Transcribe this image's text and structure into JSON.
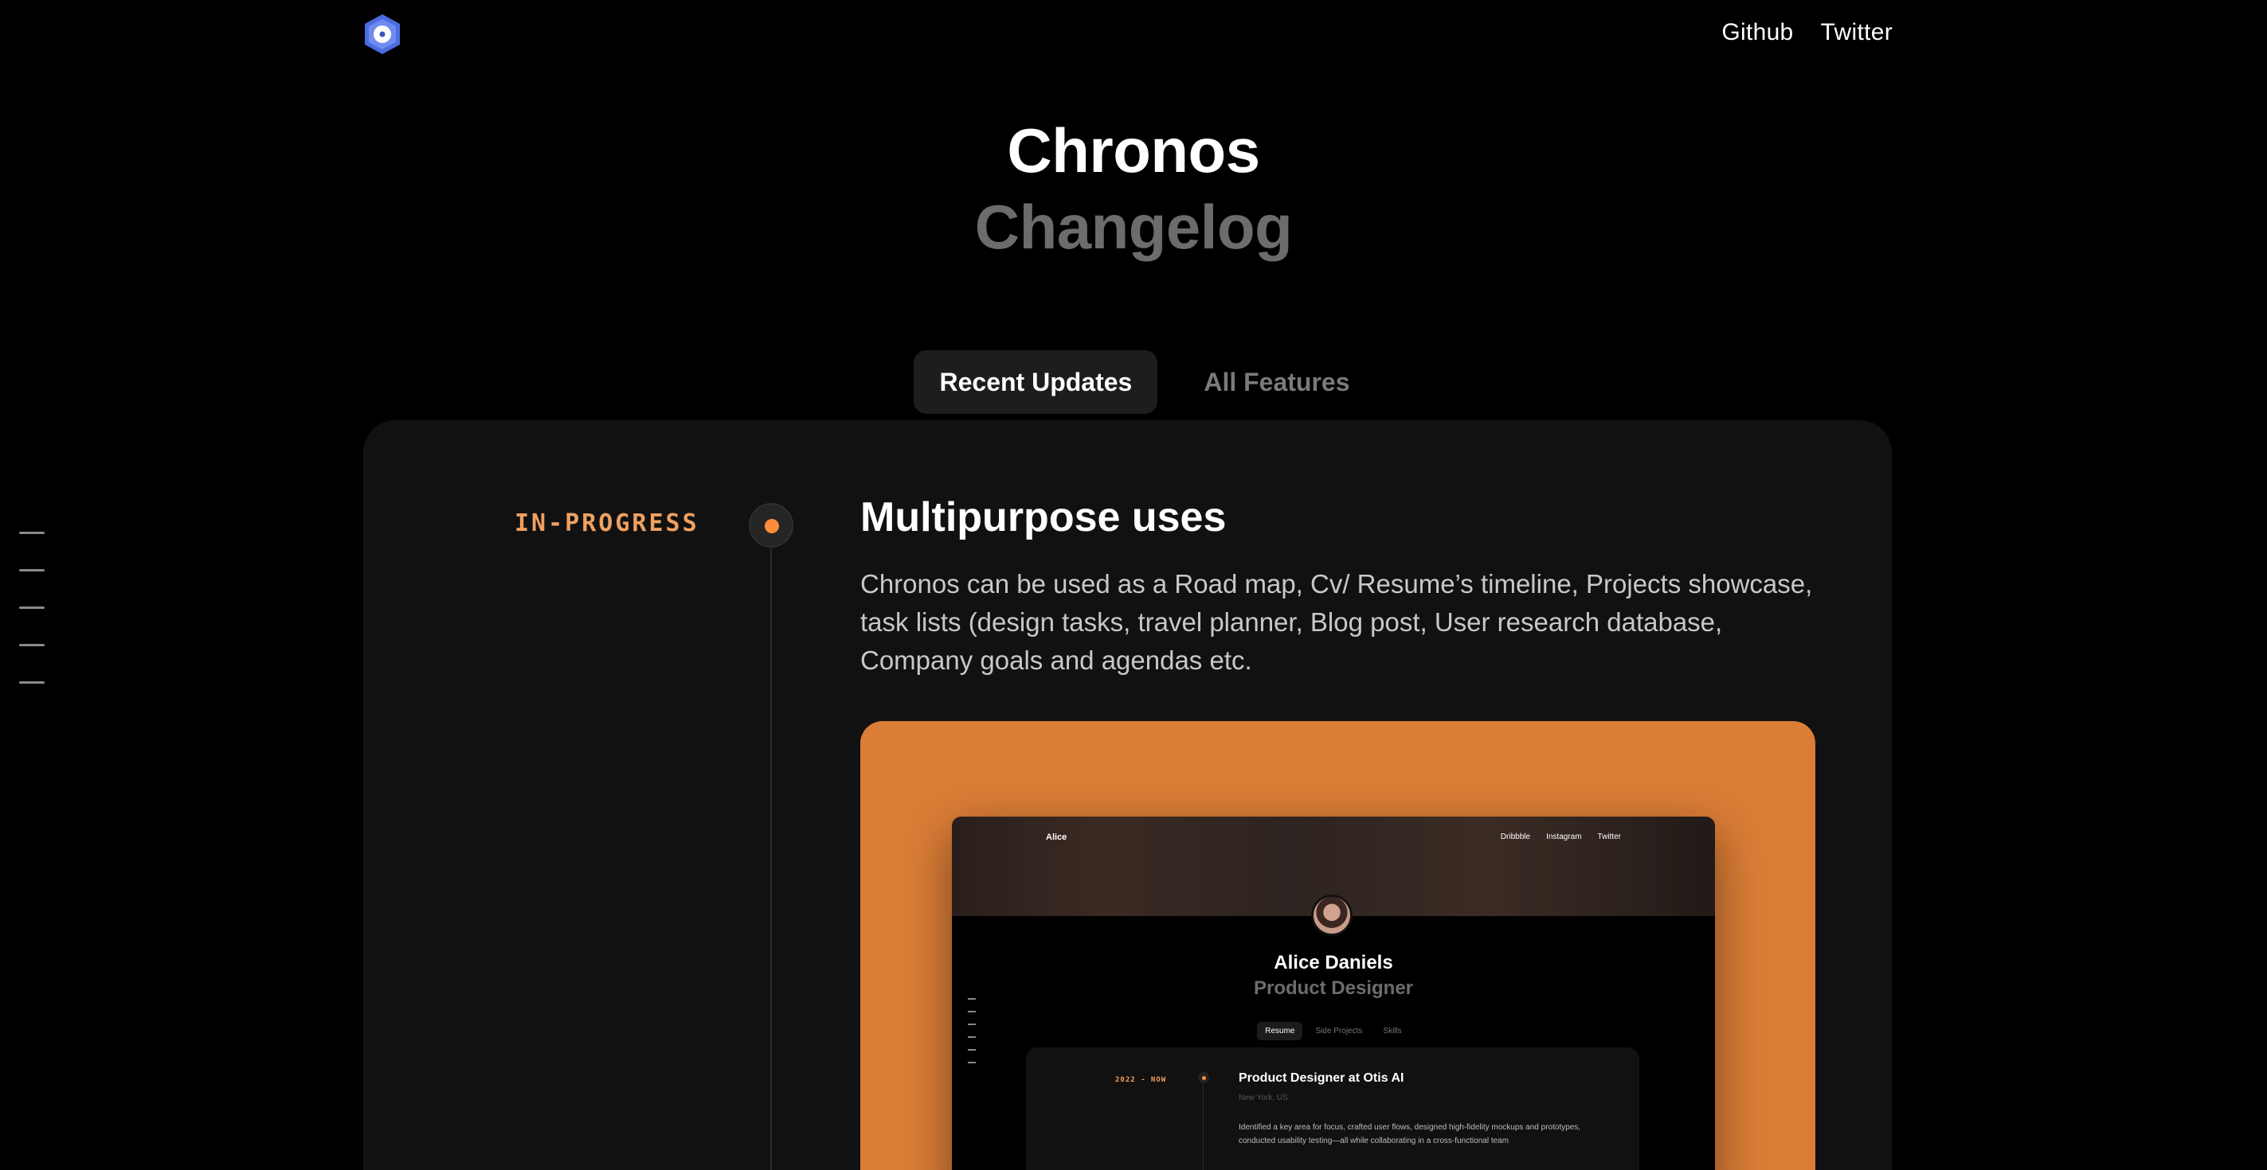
{
  "header": {
    "nav": [
      "Github",
      "Twitter"
    ]
  },
  "hero": {
    "title": "Chronos",
    "subtitle": "Changelog"
  },
  "tabs": [
    {
      "label": "Recent Updates",
      "active": true
    },
    {
      "label": "All Features",
      "active": false
    }
  ],
  "entry": {
    "status": "IN-PROGRESS",
    "title": "Multipurpose uses",
    "description": "Chronos can be used as a Road map, Cv/ Resume’s timeline, Projects showcase, task lists (design tasks, travel planner, Blog post, User research database, Company goals and agendas etc."
  },
  "preview": {
    "brand": "Alice",
    "nav": [
      "Dribbble",
      "Instagram",
      "Twitter"
    ],
    "name": "Alice Daniels",
    "role": "Product Designer",
    "tabs": [
      "Resume",
      "Side Projects",
      "Skills"
    ],
    "timeline": {
      "date": "2022 - NOW",
      "title": "Product Designer at Otis AI",
      "location": "New York, US",
      "description": "Identified a key area for focus, crafted user flows, designed high-fidelity mockups and prototypes, conducted usability testing—all while collaborating in a cross-functional team"
    }
  },
  "colors": {
    "accent": "#ff8c3a",
    "showcase_bg": "#da7d36",
    "logo": "#4a6ee0",
    "panel": "#111111"
  },
  "icons": {
    "logo": "hexagon-logo-icon"
  }
}
